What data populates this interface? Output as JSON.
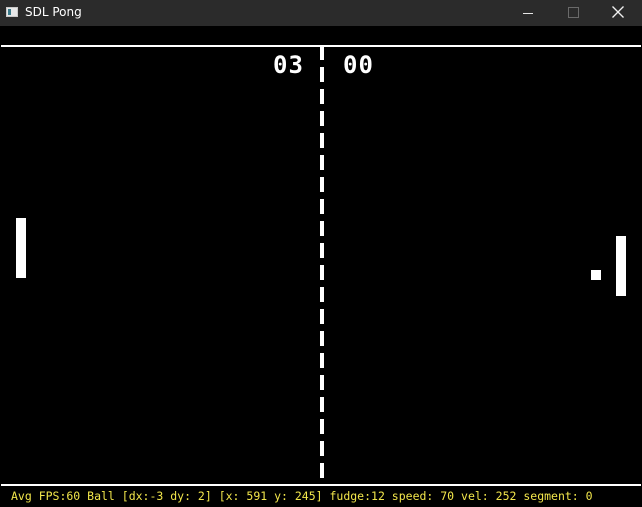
{
  "window": {
    "title": "SDL Pong",
    "icon": "app-window-icon",
    "controls": {
      "minimize_icon": "minimize-icon",
      "maximize_icon": "maximize-icon",
      "close_icon": "close-icon"
    }
  },
  "game": {
    "score_left": "03",
    "score_right": "00"
  },
  "status": {
    "text": "Avg FPS:60 Ball [dx:-3 dy: 2] [x: 591 y: 245] fudge:12 speed: 70 vel: 252 segment: 0",
    "color": "#f2e64b"
  },
  "colors": {
    "background": "#000000",
    "foreground": "#ffffff",
    "titlebar": "#2b2b2b"
  }
}
